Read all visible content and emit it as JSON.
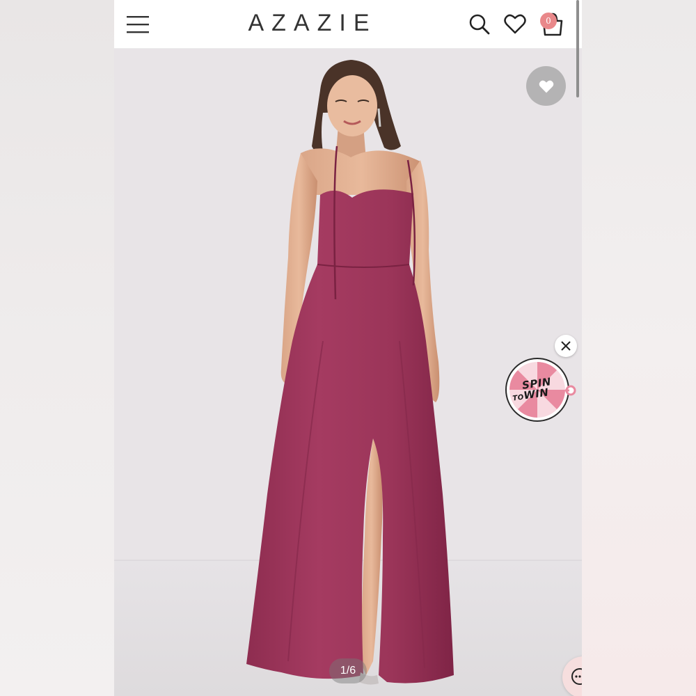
{
  "header": {
    "logo": "AZAZIE",
    "cart_count": "0",
    "icons": [
      "menu-icon",
      "search-icon",
      "heart-icon",
      "cart-icon"
    ]
  },
  "product": {
    "image_counter": "1/6",
    "dress_color": "#a53b61",
    "backdrop_color": "#e8e4e7"
  },
  "promo": {
    "spin_line1": "SPIN",
    "spin_to": "TO",
    "spin_win": "WIN"
  },
  "colors": {
    "badge": "#e9888a",
    "fav_button": "#aaaaaa",
    "chat_button": "#f6dede"
  }
}
